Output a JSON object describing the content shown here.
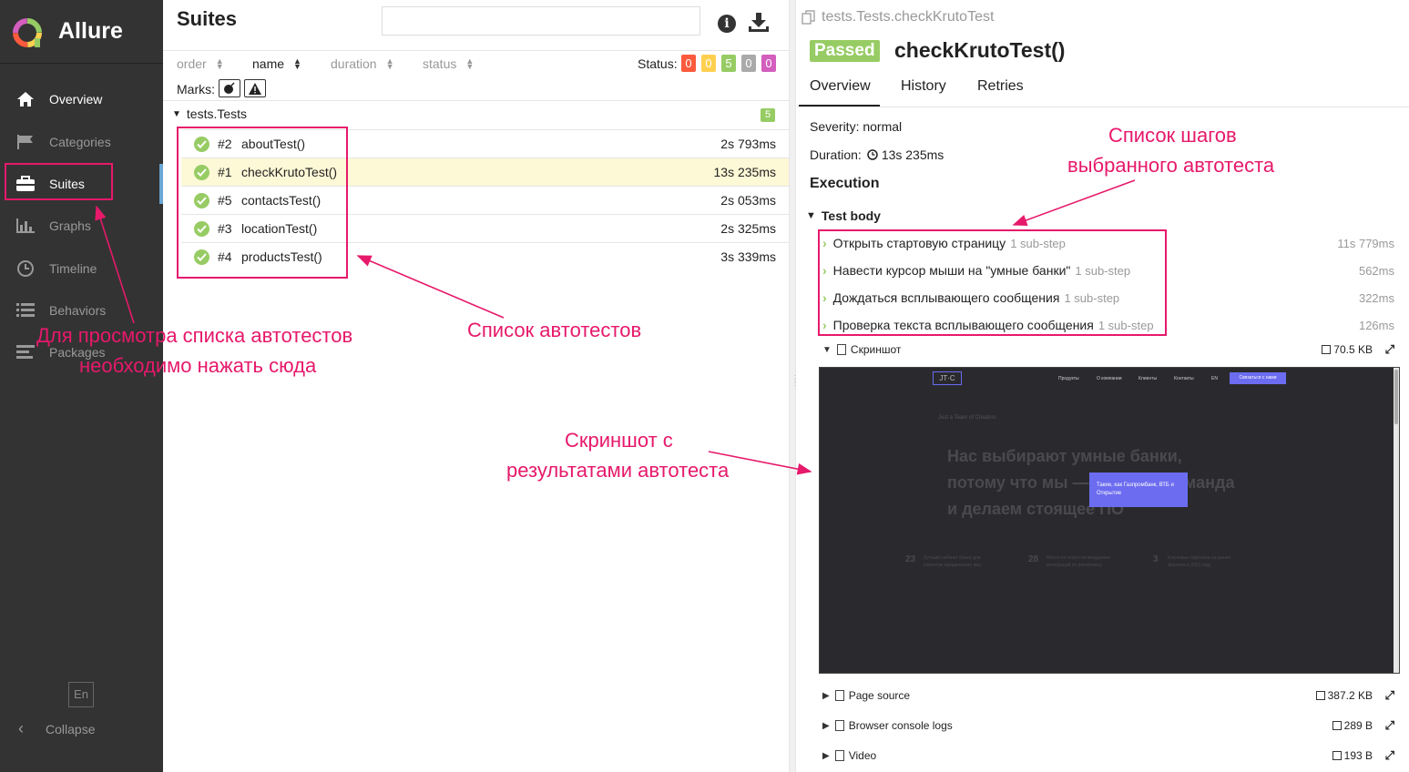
{
  "app": {
    "brand": "Allure",
    "nav": [
      {
        "label": "Overview",
        "icon": "home-icon"
      },
      {
        "label": "Categories",
        "icon": "flag-icon"
      },
      {
        "label": "Suites",
        "icon": "briefcase-icon"
      },
      {
        "label": "Graphs",
        "icon": "bar-chart-icon"
      },
      {
        "label": "Timeline",
        "icon": "clock-icon"
      },
      {
        "label": "Behaviors",
        "icon": "list-icon"
      },
      {
        "label": "Packages",
        "icon": "align-left-icon"
      }
    ],
    "language": "En",
    "collapse_label": "Collapse"
  },
  "suites": {
    "title": "Suites",
    "search_placeholder": "",
    "sort": {
      "order": "order",
      "name": "name",
      "duration": "duration",
      "status": "status"
    },
    "status_label": "Status:",
    "status_counts": [
      {
        "count": "0",
        "color": "#fd5a3e"
      },
      {
        "count": "0",
        "color": "#ffd050"
      },
      {
        "count": "5",
        "color": "#97cc64"
      },
      {
        "count": "0",
        "color": "#aaaaaa"
      },
      {
        "count": "0",
        "color": "#d35ebe"
      }
    ],
    "marks_label": "Marks:",
    "group": {
      "name": "tests.Tests",
      "count": "5"
    },
    "tests": [
      {
        "num": "#2",
        "name": "aboutTest()",
        "duration": "2s 793ms",
        "selected": false
      },
      {
        "num": "#1",
        "name": "checkKrutoTest()",
        "duration": "13s 235ms",
        "selected": true
      },
      {
        "num": "#5",
        "name": "contactsTest()",
        "duration": "2s 053ms",
        "selected": false
      },
      {
        "num": "#3",
        "name": "locationTest()",
        "duration": "2s 325ms",
        "selected": false
      },
      {
        "num": "#4",
        "name": "productsTest()",
        "duration": "3s 339ms",
        "selected": false
      }
    ]
  },
  "detail": {
    "breadcrumb": "tests.Tests.checkKrutoTest",
    "status": "Passed",
    "title": "checkKrutoTest()",
    "tabs": [
      "Overview",
      "History",
      "Retries"
    ],
    "severity": "Severity: normal",
    "duration_label": "Duration:",
    "duration_value": "13s 235ms",
    "execution": "Execution",
    "test_body": "Test body",
    "steps": [
      {
        "name": "Открыть стартовую страницу",
        "sub": "1 sub-step",
        "duration": "11s 779ms"
      },
      {
        "name": "Навести курсор мыши на \"умные банки\"",
        "sub": "1 sub-step",
        "duration": "562ms"
      },
      {
        "name": "Дождаться всплывающего сообщения",
        "sub": "1 sub-step",
        "duration": "322ms"
      },
      {
        "name": "Проверка текста всплывающего сообщения",
        "sub": "1 sub-step",
        "duration": "126ms"
      }
    ],
    "attachments": [
      {
        "name": "Скриншот",
        "size": "70.5 KB",
        "expanded": true
      },
      {
        "name": "Page source",
        "size": "387.2 KB",
        "expanded": false
      },
      {
        "name": "Browser console logs",
        "size": "289 B",
        "expanded": false
      },
      {
        "name": "Video",
        "size": "193 B",
        "expanded": false
      }
    ],
    "screenshot": {
      "logo": "JT·C",
      "nav": [
        "Продукты",
        "О компании",
        "Клиенты",
        "Контакты",
        "EN"
      ],
      "cta": "Связаться с нами",
      "tagline": "Just a Team of Creators",
      "headline": [
        "Нас выбирают умные банки,",
        "потому что мы — сильная команда",
        "и делаем стоящее ПО"
      ],
      "popup": "Такие, как Газпромбанк, ВТБ и Открытие",
      "stats": [
        {
          "num": "23",
          "text": "Лучший кабинет банка для клиентов юридических лиц"
        },
        {
          "num": "28",
          "text": "Место по скорости внедрения интеграций по ритейлингу"
        },
        {
          "num": "3",
          "text": "Ключевых партнера на рынке финтеха в 2021 году"
        }
      ]
    }
  },
  "annotations": {
    "suites_hint": [
      "Для просмотра списка автотестов",
      "необходимо нажать сюда"
    ],
    "tests_list": "Список автотестов",
    "steps_list": [
      "Список шагов",
      "выбранного автотеста"
    ],
    "screenshot": [
      "Скриншот с",
      "результатами автотеста"
    ],
    "color": "#e6196b"
  }
}
